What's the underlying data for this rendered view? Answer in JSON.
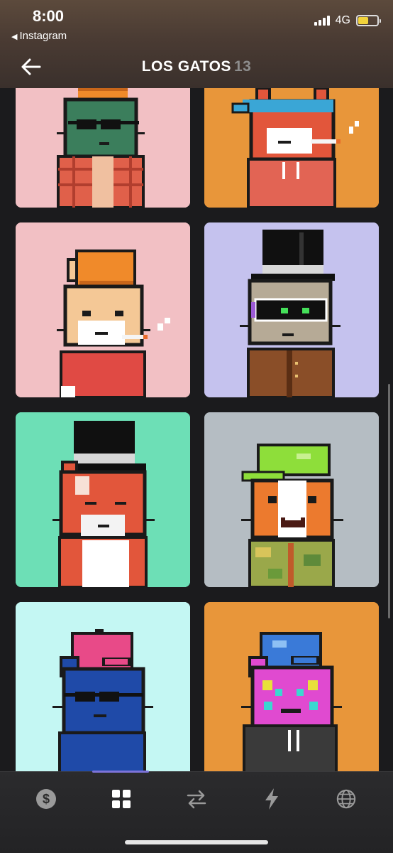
{
  "status": {
    "time": "8:00",
    "back_app": "Instagram",
    "network": "4G"
  },
  "header": {
    "title": "LOS GATOS",
    "count": "13"
  },
  "colors": {
    "pink": "#f2c0c4",
    "orange": "#e8963a",
    "lavender": "#c5c2ee",
    "mint": "#6ddfb6",
    "gray": "#b5bdc3",
    "ice": "#c4f7f3"
  },
  "tabs": [
    {
      "name": "wallet",
      "icon": "dollar-icon"
    },
    {
      "name": "collection",
      "icon": "grid-icon",
      "active": true
    },
    {
      "name": "trade",
      "icon": "swap-arrows-icon"
    },
    {
      "name": "activity",
      "icon": "lightning-icon"
    },
    {
      "name": "explore",
      "icon": "globe-icon"
    }
  ]
}
